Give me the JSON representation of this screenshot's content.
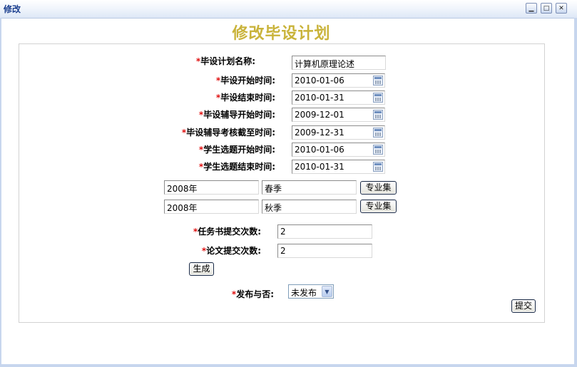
{
  "window": {
    "title": "修改",
    "controls": {
      "minimize": "0",
      "maximize": "1",
      "close": "r"
    }
  },
  "page": {
    "title": "修改毕设计划"
  },
  "form": {
    "required_mark": "*",
    "plan_name": {
      "label": "毕设计划名称:",
      "value": "计算机原理论述"
    },
    "start_time": {
      "label": "毕设开始时间:",
      "value": "2010-01-06"
    },
    "end_time": {
      "label": "毕设结束时间:",
      "value": "2010-01-31"
    },
    "tutor_start": {
      "label": "毕设辅导开始时间:",
      "value": "2009-12-01"
    },
    "tutor_deadline": {
      "label": "毕设辅导考核截至时间:",
      "value": "2009-12-31"
    },
    "select_start": {
      "label": "学生选题开始时间:",
      "value": "2010-01-06"
    },
    "select_end": {
      "label": "学生选题结束时间:",
      "value": "2010-01-31"
    },
    "semesters": [
      {
        "year": "2008年",
        "season": "春季",
        "button": "专业集"
      },
      {
        "year": "2008年",
        "season": "秋季",
        "button": "专业集"
      }
    ],
    "task_count": {
      "label": "任务书提交次数:",
      "value": "2"
    },
    "paper_count": {
      "label": "论文提交次数:",
      "value": "2"
    },
    "generate_button": "生成",
    "publish": {
      "label": "发布与否:",
      "selected": "未发布"
    },
    "submit_button": "提交"
  }
}
